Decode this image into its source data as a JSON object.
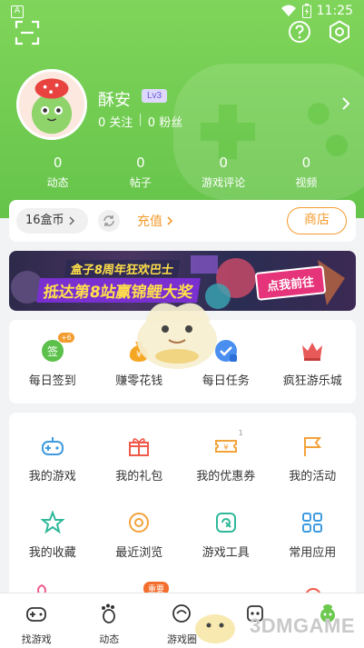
{
  "status_bar": {
    "time": "11:25",
    "left_icon": "A"
  },
  "profile": {
    "username": "酥安",
    "level": "Lv3",
    "following": "0 关注",
    "followers": "0 粉丝"
  },
  "stats": [
    {
      "num": "0",
      "label": "动态"
    },
    {
      "num": "0",
      "label": "帖子"
    },
    {
      "num": "0",
      "label": "游戏评论"
    },
    {
      "num": "0",
      "label": "视频"
    }
  ],
  "coins": {
    "amount": "16盒币",
    "recharge": "充值",
    "shop": "商店"
  },
  "banner": {
    "line1": "盒子8周年狂欢巴士",
    "line2": "抵达第8站赢锦鲤大奖",
    "cta": "点我前往"
  },
  "daily": [
    {
      "label": "每日签到",
      "badge": "+6",
      "icon": "checkin-icon"
    },
    {
      "label": "赚零花钱",
      "icon": "money-bag-icon"
    },
    {
      "label": "每日任务",
      "icon": "task-icon"
    },
    {
      "label": "疯狂游乐城",
      "icon": "crown-icon"
    }
  ],
  "features": [
    {
      "label": "我的游戏",
      "icon": "gamepad-icon"
    },
    {
      "label": "我的礼包",
      "icon": "gift-icon"
    },
    {
      "label": "我的优惠券",
      "icon": "coupon-icon",
      "badge": "1"
    },
    {
      "label": "我的活动",
      "icon": "flag-icon"
    },
    {
      "label": "我的收藏",
      "icon": "star-icon"
    },
    {
      "label": "最近浏览",
      "icon": "eye-icon"
    },
    {
      "label": "游戏工具",
      "icon": "tool-icon"
    },
    {
      "label": "常用应用",
      "icon": "apps-icon"
    }
  ],
  "hot_badge": "重要",
  "tabs": [
    {
      "label": "找游戏",
      "icon": "gamepad-tab-icon"
    },
    {
      "label": "动态",
      "icon": "footprint-icon"
    },
    {
      "label": "游戏圈",
      "icon": "circle-icon"
    },
    {
      "label": "",
      "icon": "game-tab-icon"
    },
    {
      "label": "",
      "icon": "me-tab-icon"
    }
  ],
  "watermark": "3DMGAME",
  "colors": {
    "green": "#6cc94e",
    "orange": "#f39b2d",
    "level_bg": "#ded8ff"
  }
}
